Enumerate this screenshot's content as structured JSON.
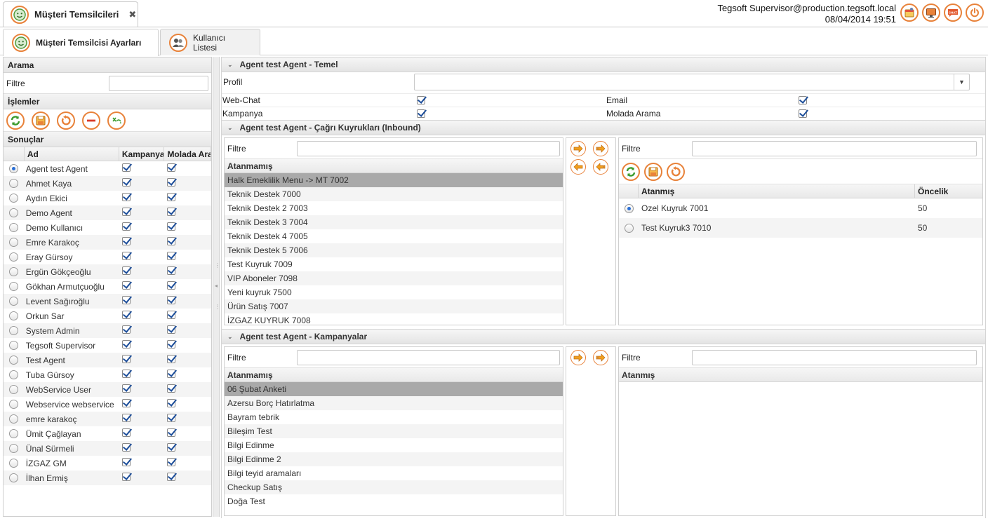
{
  "top": {
    "tab_title": "Müşteri Temsilcileri",
    "close_glyph": "✖",
    "user": "Tegsoft Supervisor@production.tegsoft.local",
    "datetime": "08/04/2014 19:51",
    "icons": [
      "calendar-icon",
      "monitor-icon",
      "chat-icon",
      "power-icon"
    ],
    "chat_label": "CHAT"
  },
  "tabs": [
    {
      "label": "Müşteri Temsilcisi Ayarları",
      "active": true
    },
    {
      "label": "Kullanıcı Listesi",
      "active": false
    }
  ],
  "left": {
    "search_header": "Arama",
    "filter_label": "Filtre",
    "actions_header": "İşlemler",
    "results_header": "Sonuçlar",
    "columns": [
      "Ad",
      "Kampanya",
      "Molada Arama"
    ],
    "rows": [
      {
        "name": "Agent test Agent",
        "selected": true
      },
      {
        "name": "Ahmet Kaya"
      },
      {
        "name": "Aydın Ekici"
      },
      {
        "name": "Demo Agent"
      },
      {
        "name": "Demo Kullanıcı"
      },
      {
        "name": "Emre Karakoç"
      },
      {
        "name": "Eray Gürsoy"
      },
      {
        "name": "Ergün Gökçeoğlu"
      },
      {
        "name": "Gökhan Armutçuoğlu"
      },
      {
        "name": "Levent Sağıroğlu"
      },
      {
        "name": "Orkun Sar"
      },
      {
        "name": "System Admin"
      },
      {
        "name": "Tegsoft Supervisor"
      },
      {
        "name": "Test Agent"
      },
      {
        "name": "Tuba Gürsoy"
      },
      {
        "name": "WebService User"
      },
      {
        "name": "Webservice webservice"
      },
      {
        "name": "emre karakoç"
      },
      {
        "name": "Ümit Çağlayan"
      },
      {
        "name": "Ünal Sürmeli"
      },
      {
        "name": "İZGAZ GM"
      },
      {
        "name": "İlhan Ermiş"
      }
    ]
  },
  "temel": {
    "title": "Agent test Agent - Temel",
    "profil_label": "Profil",
    "profil_value": "",
    "webchat_label": "Web-Chat",
    "email_label": "Email",
    "kampanya_label": "Kampanya",
    "molada_label": "Molada Arama"
  },
  "queues": {
    "title": "Agent test Agent - Çağrı Kuyrukları (Inbound)",
    "filter_label": "Filtre",
    "unassigned_header": "Atanmamış",
    "unassigned": [
      "Halk Emeklilik Menu -> MT 7002",
      "Teknik Destek 7000",
      "Teknik Destek 2 7003",
      "Teknik Destek 3 7004",
      "Teknik Destek 4 7005",
      "Teknik Destek 5 7006",
      "Test Kuyruk 7009",
      "VIP Aboneler 7098",
      "Yeni kuyruk 7500",
      "Ürün Satış 7007",
      "İZGAZ KUYRUK 7008"
    ],
    "assigned_header": "Atanmış",
    "priority_header": "Öncelik",
    "assigned": [
      {
        "name": "Ozel Kuyruk 7001",
        "priority": "50",
        "selected": true
      },
      {
        "name": "Test Kuyruk3 7010",
        "priority": "50"
      }
    ]
  },
  "campaigns": {
    "title": "Agent test Agent - Kampanyalar",
    "filter_label": "Filtre",
    "unassigned_header": "Atanmamış",
    "unassigned": [
      "06 Şubat Anketi",
      "Azersu Borç Hatırlatma",
      "Bayram tebrik",
      "Bileşim Test",
      "Bilgi Edinme",
      "Bilgi Edinme 2",
      "Bilgi teyid aramaları",
      "Checkup Satış",
      "Doğa Test"
    ],
    "assigned_header": "Atanmış"
  },
  "colors": {
    "accent": "#e8823a",
    "green": "#3a9a2c",
    "check": "#1d4e9a",
    "selected_row": "#a9a9a9"
  }
}
